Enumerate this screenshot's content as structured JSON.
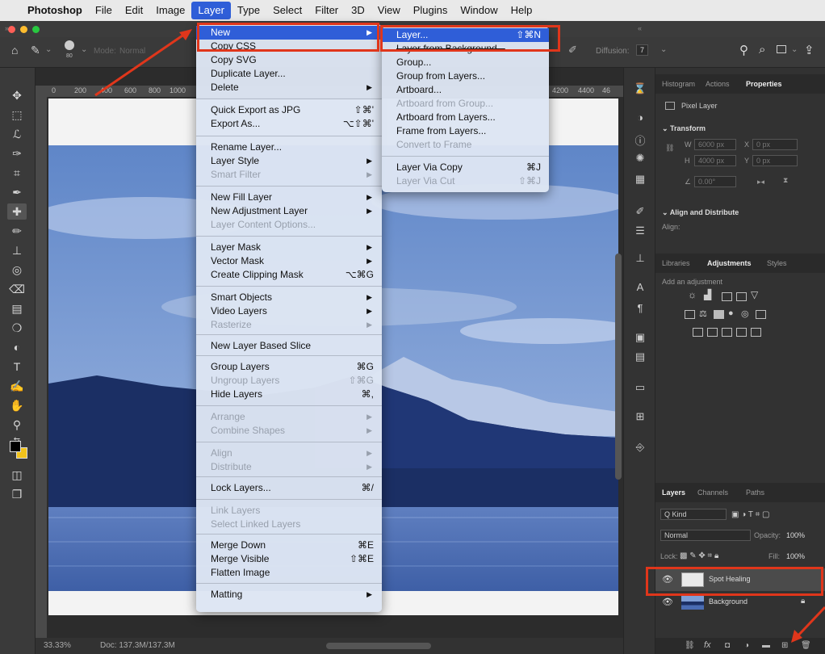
{
  "menubar": {
    "apple_icon": "apple-icon",
    "items": [
      "Photoshop",
      "File",
      "Edit",
      "Image",
      "Layer",
      "Type",
      "Select",
      "Filter",
      "3D",
      "View",
      "Plugins",
      "Window",
      "Help"
    ]
  },
  "options_bar": {
    "brush_size": "80",
    "mode_label": "Mode:",
    "mode_value": "Normal",
    "diffusion_label": "Diffusion:",
    "diffusion_value": "7"
  },
  "rulers": {
    "h_ticks": [
      "0",
      "200",
      "400",
      "600",
      "800",
      "1000",
      "4200",
      "4400",
      "46"
    ]
  },
  "status": {
    "zoom": "33.33%",
    "doc": "Doc: 137.3M/137.3M"
  },
  "layer_menu": {
    "items": [
      {
        "label": "New",
        "submenu": true,
        "highlighted": true
      },
      {
        "label": "Copy CSS"
      },
      {
        "label": "Copy SVG"
      },
      {
        "label": "Duplicate Layer..."
      },
      {
        "label": "Delete",
        "submenu": true
      },
      {
        "label": "Quick Export as JPG",
        "shortcut": "⇧⌘'"
      },
      {
        "label": "Export As...",
        "shortcut": "⌥⇧⌘'"
      },
      {
        "label": "Rename Layer..."
      },
      {
        "label": "Layer Style",
        "submenu": true
      },
      {
        "label": "Smart Filter",
        "submenu": true,
        "disabled": true
      },
      {
        "label": "New Fill Layer",
        "submenu": true
      },
      {
        "label": "New Adjustment Layer",
        "submenu": true
      },
      {
        "label": "Layer Content Options...",
        "disabled": true
      },
      {
        "label": "Layer Mask",
        "submenu": true
      },
      {
        "label": "Vector Mask",
        "submenu": true
      },
      {
        "label": "Create Clipping Mask",
        "shortcut": "⌥⌘G"
      },
      {
        "label": "Smart Objects",
        "submenu": true
      },
      {
        "label": "Video Layers",
        "submenu": true
      },
      {
        "label": "Rasterize",
        "submenu": true,
        "disabled": true
      },
      {
        "label": "New Layer Based Slice"
      },
      {
        "label": "Group Layers",
        "shortcut": "⌘G"
      },
      {
        "label": "Ungroup Layers",
        "shortcut": "⇧⌘G",
        "disabled": true
      },
      {
        "label": "Hide Layers",
        "shortcut": "⌘,"
      },
      {
        "label": "Arrange",
        "submenu": true,
        "disabled": true
      },
      {
        "label": "Combine Shapes",
        "submenu": true,
        "disabled": true
      },
      {
        "label": "Align",
        "submenu": true,
        "disabled": true
      },
      {
        "label": "Distribute",
        "submenu": true,
        "disabled": true
      },
      {
        "label": "Lock Layers...",
        "shortcut": "⌘/"
      },
      {
        "label": "Link Layers",
        "disabled": true
      },
      {
        "label": "Select Linked Layers",
        "disabled": true
      },
      {
        "label": "Merge Down",
        "shortcut": "⌘E"
      },
      {
        "label": "Merge Visible",
        "shortcut": "⇧⌘E"
      },
      {
        "label": "Flatten Image"
      },
      {
        "label": "Matting",
        "submenu": true
      }
    ]
  },
  "new_submenu": {
    "items": [
      {
        "label": "Layer...",
        "shortcut": "⇧⌘N",
        "highlighted": true
      },
      {
        "label": "Layer from Background...",
        "strikethrough": true
      },
      {
        "label": "Group..."
      },
      {
        "label": "Group from Layers..."
      },
      {
        "label": "Artboard..."
      },
      {
        "label": "Artboard from Group...",
        "disabled": true
      },
      {
        "label": "Artboard from Layers..."
      },
      {
        "label": "Frame from Layers..."
      },
      {
        "label": "Convert to Frame",
        "disabled": true
      },
      {
        "label": "Layer Via Copy",
        "shortcut": "⌘J"
      },
      {
        "label": "Layer Via Cut",
        "shortcut": "⇧⌘J",
        "disabled": true
      }
    ]
  },
  "panels": {
    "top_tabs": [
      "Histogram",
      "Actions",
      "Properties"
    ],
    "pixel_layer": "Pixel Layer",
    "transform": "Transform",
    "w_label": "W",
    "w_value": "6000 px",
    "x_label": "X",
    "x_value": "0 px",
    "h_label": "H",
    "h_value": "4000 px",
    "y_label": "Y",
    "y_value": "0 px",
    "angle_value": "0.00°",
    "align_distribute": "Align and Distribute",
    "align_label": "Align:",
    "mid_tabs": [
      "Libraries",
      "Adjustments",
      "Styles"
    ],
    "add_adjustment": "Add an adjustment",
    "layer_tabs": [
      "Layers",
      "Channels",
      "Paths"
    ],
    "kind_label": "Q Kind",
    "blend_mode": "Normal",
    "opacity_label": "Opacity:",
    "opacity_value": "100%",
    "lock_label": "Lock:",
    "fill_label": "Fill:",
    "fill_value": "100%",
    "layers": [
      {
        "name": "Spot Healing",
        "visible": true,
        "selected": true
      },
      {
        "name": "Background",
        "visible": true,
        "locked": true
      }
    ]
  },
  "colors": {
    "highlight": "#2f5ed8",
    "annotation_red": "#e0361b"
  }
}
